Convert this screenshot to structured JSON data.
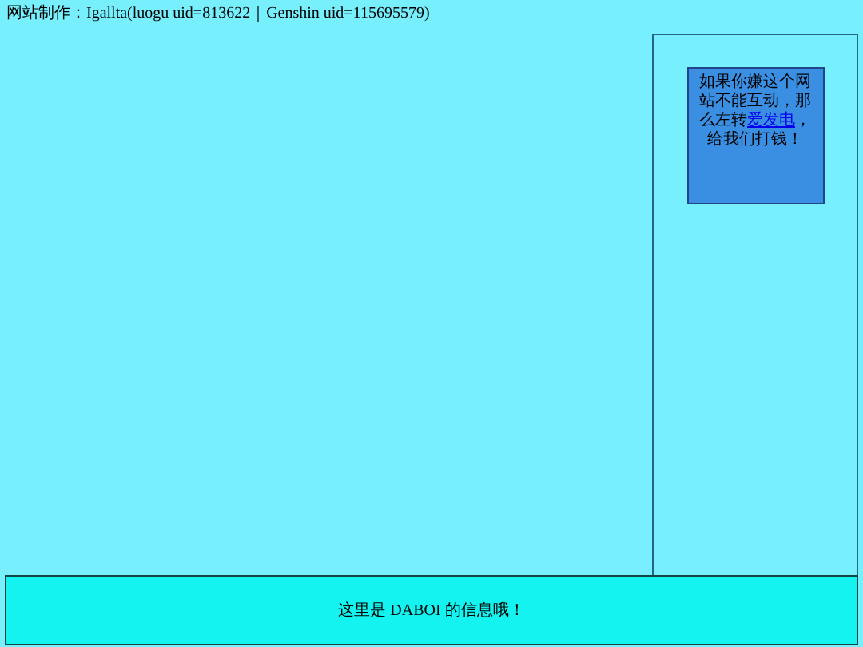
{
  "header": {
    "credit": "网站制作：Igallta(luogu uid=813622｜Genshin uid=115695579)"
  },
  "sidebar": {
    "notice": {
      "before": "如果你嫌这个网站不能互动，那么左转",
      "link": "爱发电",
      "after": "，给我们打钱！"
    }
  },
  "footer": {
    "text": "这里是 DABOI 的信息哦！"
  }
}
